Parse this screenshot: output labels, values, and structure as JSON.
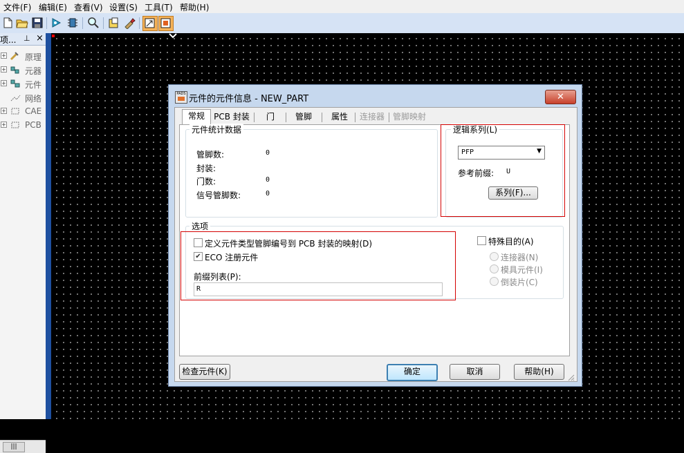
{
  "menubar": {
    "items": [
      {
        "label": "文件(F)"
      },
      {
        "label": "编辑(E)"
      },
      {
        "label": "查看(V)"
      },
      {
        "label": "设置(S)"
      },
      {
        "label": "工具(T)"
      },
      {
        "label": "帮助(H)"
      }
    ]
  },
  "toolbar": {
    "icons": [
      "new-icon",
      "open-icon",
      "save-icon",
      "run-icon",
      "chip-icon",
      "zoom-icon",
      "part-editor-icon",
      "paint-icon",
      "schematic-mode-icon",
      "layout-mode-icon"
    ]
  },
  "left_panel": {
    "header_label": "项...",
    "header_pin": "⊥",
    "header_close": "×",
    "tree": [
      {
        "label": "原理",
        "icon": "schematic-icon"
      },
      {
        "label": "元器",
        "icon": "component-icon"
      },
      {
        "label": "元件",
        "icon": "part-icon"
      },
      {
        "label": "网络",
        "icon": "net-icon"
      },
      {
        "label": "CAE",
        "icon": "cae-icon"
      },
      {
        "label": "PCB",
        "icon": "pcb-icon"
      }
    ],
    "hscroll_thumb": "|||"
  },
  "dialog": {
    "title": "元件的元件信息 - NEW_PART",
    "app_icon_text": "PADS",
    "close_label": "✕",
    "tabs": [
      {
        "label": "常规",
        "state": "selected"
      },
      {
        "label": "PCB 封装",
        "state": "normal"
      },
      {
        "label": "门",
        "state": "normal"
      },
      {
        "label": "管脚",
        "state": "normal"
      },
      {
        "label": "属性",
        "state": "normal"
      },
      {
        "label": "连接器",
        "state": "disabled"
      },
      {
        "label": "管脚映射",
        "state": "disabled"
      }
    ],
    "stats": {
      "group_title": "元件统计数据",
      "rows": [
        {
          "label": "管脚数:",
          "value": "0"
        },
        {
          "label": "封装:",
          "value": ""
        },
        {
          "label": "门数:",
          "value": "0"
        },
        {
          "label": "信号管脚数:",
          "value": "0"
        }
      ]
    },
    "logic_family": {
      "group_title": "逻辑系列(L)",
      "selected": "PFP",
      "prefix_label": "参考前缀:",
      "prefix_value": "U",
      "family_button": "系列(F)..."
    },
    "options": {
      "group_title": "选项",
      "define_mapping_label": "定义元件类型管脚编号到 PCB 封装的映射(D)",
      "define_mapping_checked": false,
      "eco_label": "ECO 注册元件",
      "eco_checked": true,
      "prefix_list_label": "前缀列表(P):",
      "prefix_list_value": "R"
    },
    "special": {
      "label": "特殊目的(A)",
      "checked": false,
      "radios": [
        {
          "label": "连接器(N)"
        },
        {
          "label": "模具元件(I)"
        },
        {
          "label": "倒装片(C)"
        }
      ]
    },
    "buttons": {
      "check": "检查元件(K)",
      "ok": "确定",
      "cancel": "取消",
      "help": "帮助(H)"
    },
    "colors": {
      "highlight_box": "#d40000",
      "title_bar": "#c6d8ee",
      "close_button": "#c7402b"
    }
  }
}
